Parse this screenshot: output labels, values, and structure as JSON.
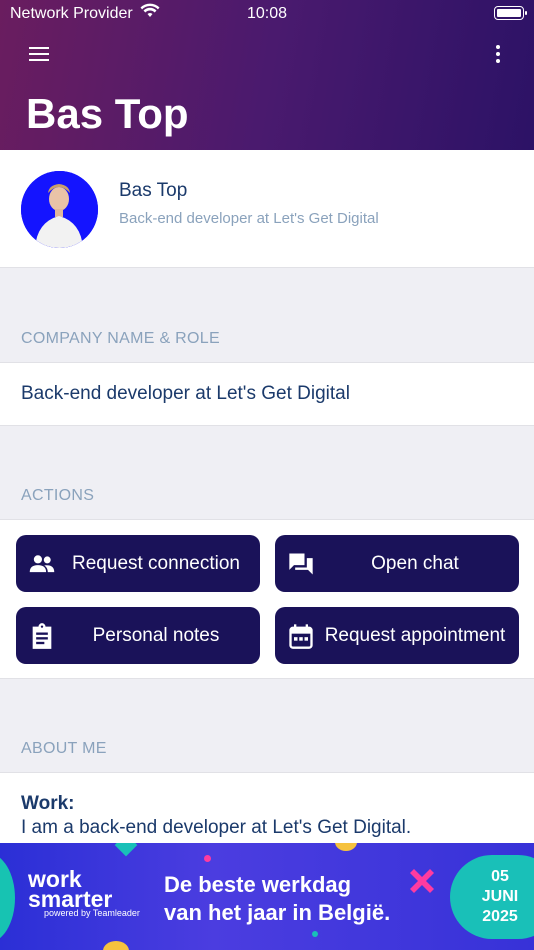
{
  "status_bar": {
    "carrier": "Network Provider",
    "time": "10:08"
  },
  "header": {
    "title": "Bas Top",
    "menu_icon": "hamburger-menu-icon",
    "more_icon": "more-vertical-icon"
  },
  "profile": {
    "name": "Bas Top",
    "subtitle": "Back-end developer at Let's Get Digital"
  },
  "company_section": {
    "label": "COMPANY NAME & ROLE",
    "value": "Back-end developer at Let's Get Digital"
  },
  "actions_section": {
    "label": "ACTIONS",
    "buttons": [
      {
        "label": "Request connection",
        "icon": "people-icon"
      },
      {
        "label": "Open chat",
        "icon": "chat-icon"
      },
      {
        "label": "Personal notes",
        "icon": "clipboard-icon"
      },
      {
        "label": "Request appointment",
        "icon": "calendar-icon"
      }
    ]
  },
  "about_section": {
    "label": "ABOUT ME",
    "work_label": "Work:",
    "work_text": "I am a back-end developer at Let's Get Digital."
  },
  "banner": {
    "brand_line1": "work",
    "brand_line2": "smarter",
    "powered_by": "powered by Teamleader",
    "tagline_line1": "De beste werkdag",
    "tagline_line2": "van het jaar in België.",
    "date_day": "05",
    "date_month": "JUNI",
    "date_year": "2025"
  },
  "colors": {
    "accent": "#1a1259",
    "header_gradient_start": "#6a1d5f",
    "header_gradient_end": "#2c1266",
    "text_primary": "#1b3a6b",
    "text_secondary": "#8aa2bc"
  }
}
